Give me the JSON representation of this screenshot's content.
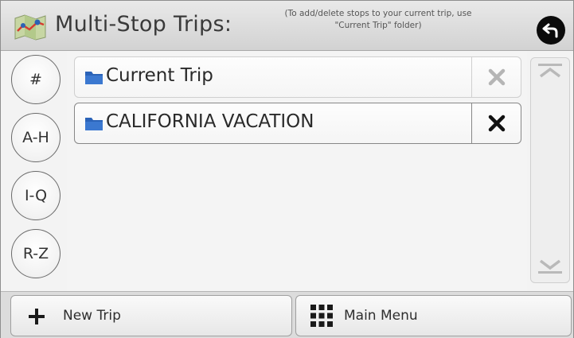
{
  "header": {
    "title": "Multi-Stop Trips:",
    "hint": "(To add/delete stops to your current trip, use \"Current Trip\" folder)",
    "map_icon": "map-icon",
    "back_icon": "back-arrow-icon"
  },
  "index_buttons": [
    "#",
    "A-H",
    "I-Q",
    "R-Z"
  ],
  "trips": [
    {
      "label": "Current Trip",
      "icon": "folder-icon",
      "delete_icon": "close-icon",
      "delete_enabled": false
    },
    {
      "label": "CALIFORNIA VACATION",
      "icon": "folder-icon",
      "delete_icon": "close-icon",
      "delete_enabled": true
    }
  ],
  "scrollbar": {
    "up_icon": "chevron-up-icon",
    "down_icon": "chevron-down-icon"
  },
  "footer": {
    "new_trip_label": "New Trip",
    "new_trip_icon": "plus-icon",
    "main_menu_label": "Main Menu",
    "main_menu_icon": "grid-icon"
  },
  "colors": {
    "folder": "#2b63b8",
    "close_enabled": "#111111",
    "close_disabled": "#b5b5b5",
    "back_button": "#0b0b0b"
  }
}
